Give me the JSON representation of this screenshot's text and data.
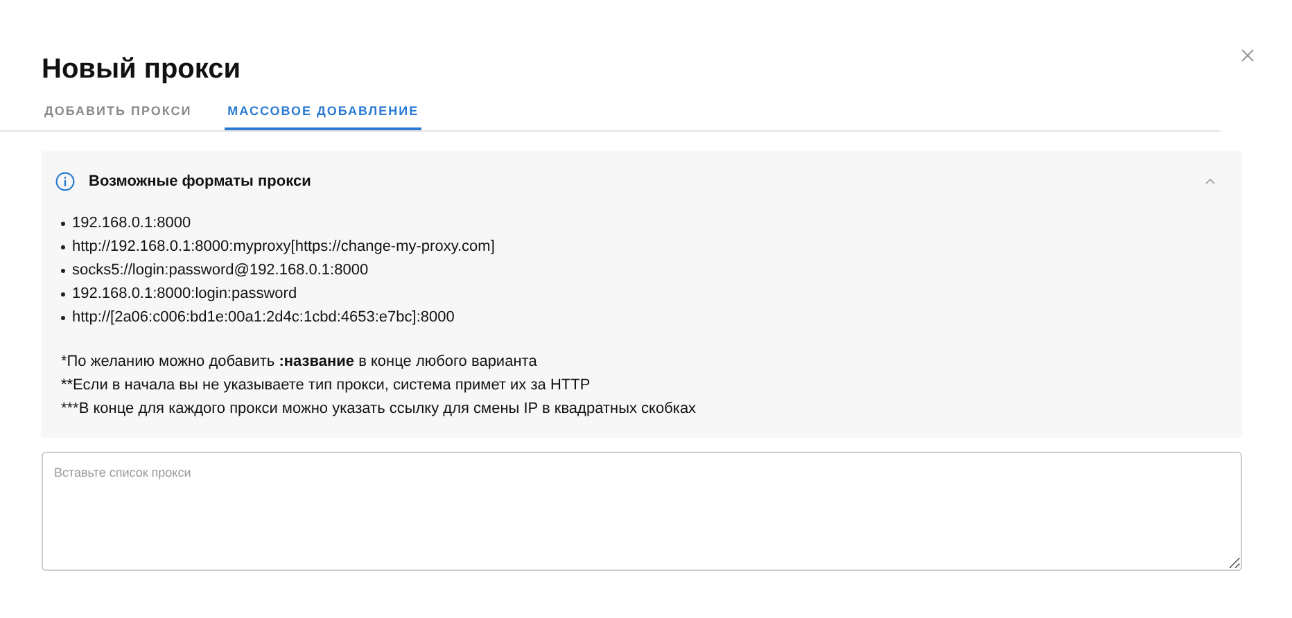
{
  "dialog": {
    "title": "Новый прокси"
  },
  "tabs": [
    {
      "label": "ДОБАВИТЬ ПРОКСИ",
      "selected": false
    },
    {
      "label": "МАССОВОЕ ДОБАВЛЕНИЕ",
      "selected": true
    }
  ],
  "formats_panel": {
    "title": "Возможные форматы прокси",
    "expanded": true,
    "formats": [
      "192.168.0.1:8000",
      "http://192.168.0.1:8000:myproxy[https://change-my-proxy.com]",
      "socks5://login:password@192.168.0.1:8000",
      "192.168.0.1:8000:login:password",
      "http://[2a06:c006:bd1e:00a1:2d4c:1cbd:4653:e7bc]:8000"
    ],
    "notes": [
      "*По желанию можно добавить **:название** в конце любого варианта",
      "**Если в начала вы не указываете тип прокси, система примет их за HTTP",
      "***В конце для каждого прокси можно указать ссылку для смены IP в квадратных скобках"
    ]
  },
  "proxy_list": {
    "placeholder": "Вставьте список прокси"
  }
}
